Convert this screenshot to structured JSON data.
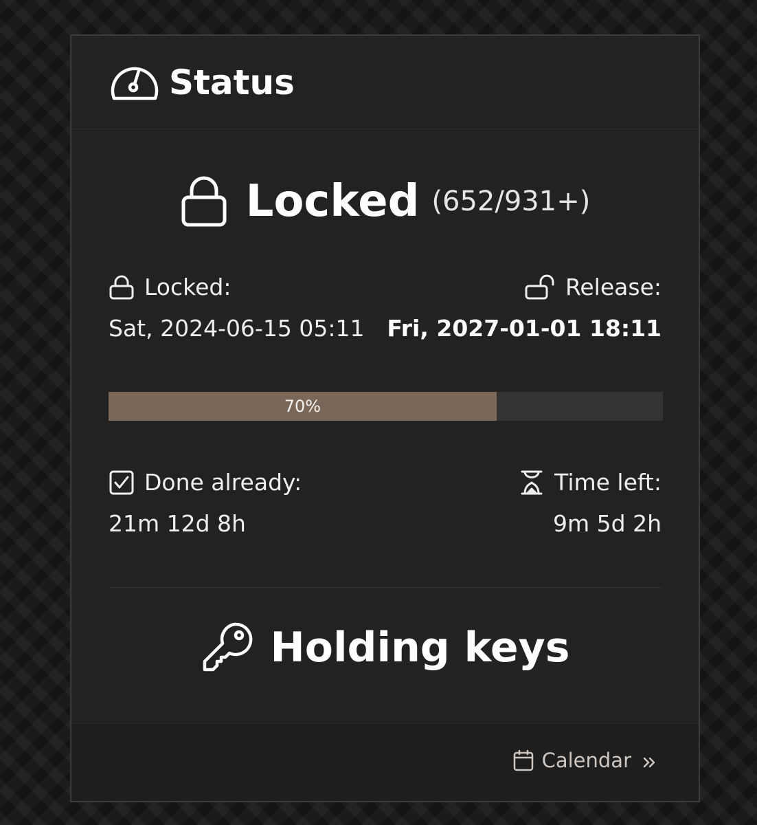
{
  "header": {
    "title": "Status",
    "icon": "gauge-icon"
  },
  "lock": {
    "state": "Locked",
    "count": "(652/931+)"
  },
  "locked": {
    "label": "Locked:",
    "value": "Sat, 2024-06-15 05:11"
  },
  "release": {
    "label": "Release:",
    "value": "Fri, 2027-01-01 18:11"
  },
  "progress": {
    "percent": 70,
    "label": "70%",
    "fill_color": "#7b6757"
  },
  "done": {
    "label": "Done already:",
    "value": "21m 12d 8h"
  },
  "left": {
    "label": "Time left:",
    "value": "9m 5d 2h"
  },
  "keys": {
    "title": "Holding keys",
    "icon": "key-icon"
  },
  "footer": {
    "calendar_label": "Calendar"
  }
}
